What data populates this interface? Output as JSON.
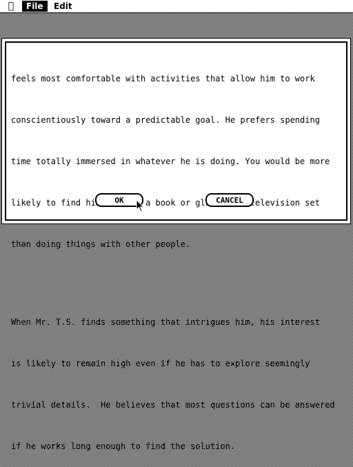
{
  "menubar": {
    "apple_icon": "apple-icon",
    "file_label": "File",
    "edit_label": "Edit"
  },
  "dialog": {
    "paragraph1": [
      "feels most comfortable with activities that allow him to work",
      "conscientiously toward a predictable goal. He prefers spending",
      "time totally immersed in whatever he is doing. You would be more",
      "likely to find him lost in a book or glued to a television set",
      "than doing things with other people."
    ],
    "paragraph2": [
      "When Mr. T.S. finds something that intrigues him, his interest",
      "is likely to remain high even if he has to explore seemingly",
      "trivial details.  He believes that most questions can be answered",
      "if he works long enough to find the solution."
    ],
    "ok_label": "OK",
    "cancel_label": "CANCEL"
  },
  "cursor": {
    "icon": "arrow-cursor-icon"
  }
}
